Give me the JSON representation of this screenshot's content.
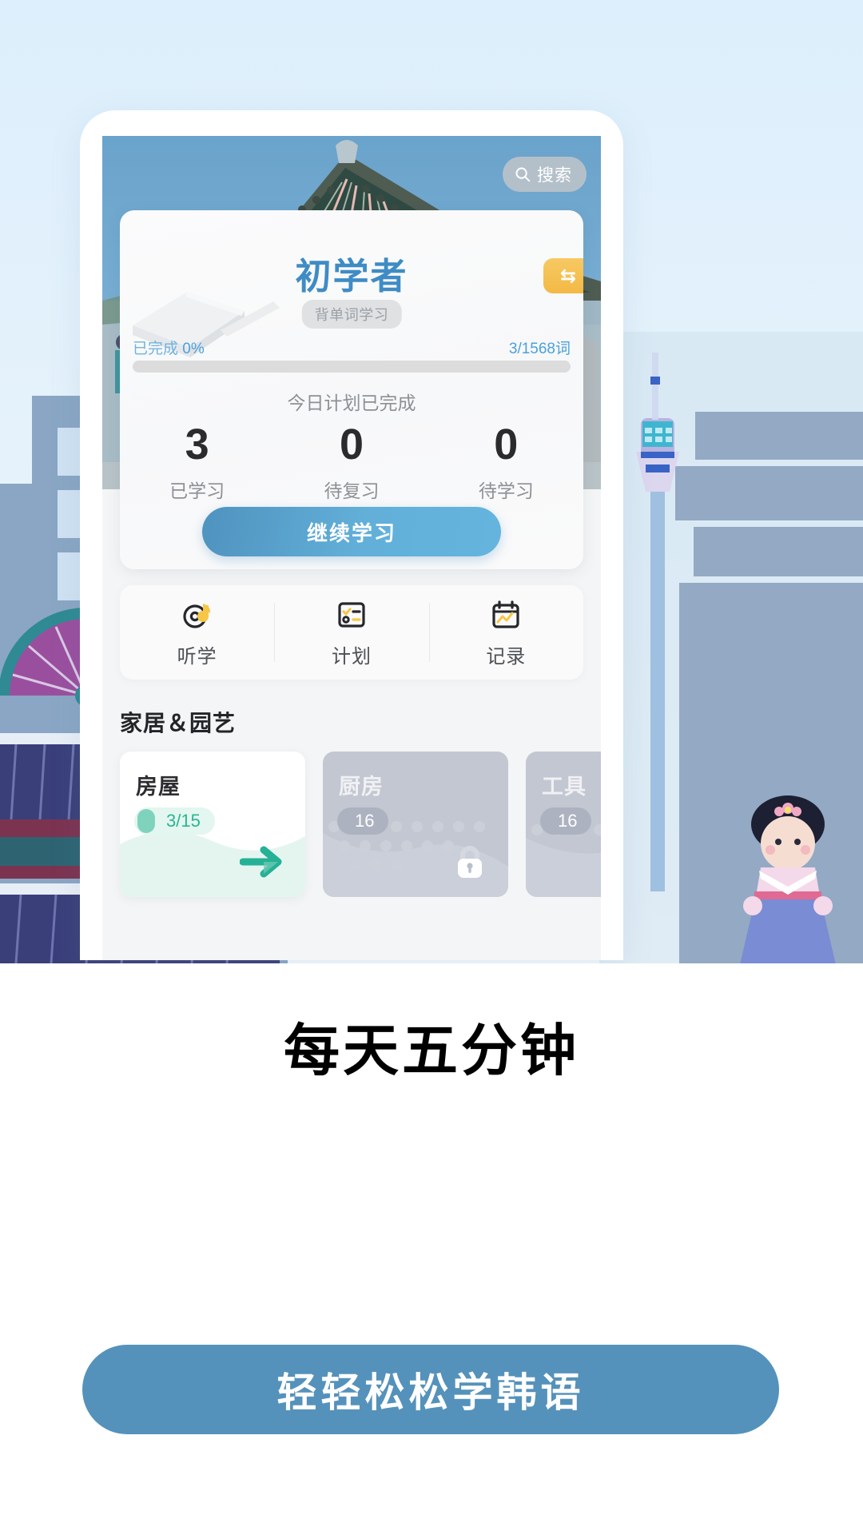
{
  "app": {
    "hero": {
      "search_label": "搜索",
      "search_icon": "search-icon"
    },
    "level_card": {
      "title": "初学者",
      "tag": "背单词学习",
      "swap_badge": "⇆",
      "progress_prefix": "已完成",
      "progress_percent": "0%",
      "progress_value": 0,
      "word_count": "3/1568词",
      "plan_label": "今日计划已完成",
      "stats": [
        {
          "value": "3",
          "label": "已学习"
        },
        {
          "value": "0",
          "label": "待复习"
        },
        {
          "value": "0",
          "label": "待学习"
        }
      ],
      "continue_label": "继续学习"
    },
    "quick_actions": [
      {
        "label": "听学",
        "icon": "listen-music-icon"
      },
      {
        "label": "计划",
        "icon": "checklist-icon"
      },
      {
        "label": "记录",
        "icon": "calendar-chart-icon"
      }
    ],
    "section": {
      "title": "家居＆园艺"
    },
    "category_cards": [
      {
        "name": "房屋",
        "badge": "3/15",
        "locked": false,
        "action_icon": "arrow-right-icon"
      },
      {
        "name": "厨房",
        "badge": "16",
        "locked": true,
        "action_icon": "lock-icon"
      },
      {
        "name": "工具",
        "badge": "16",
        "locked": true,
        "action_icon": "lock-icon"
      }
    ]
  },
  "marketing": {
    "headline": "每天五分钟",
    "cta_label": "轻轻松松学韩语"
  },
  "colors": {
    "brand_blue": "#5592bb",
    "accent_blue": "#4aa1dc",
    "accent_green": "#2bb491",
    "accent_yellow": "#f3b945",
    "locked_gray": "#c3c7d2"
  }
}
